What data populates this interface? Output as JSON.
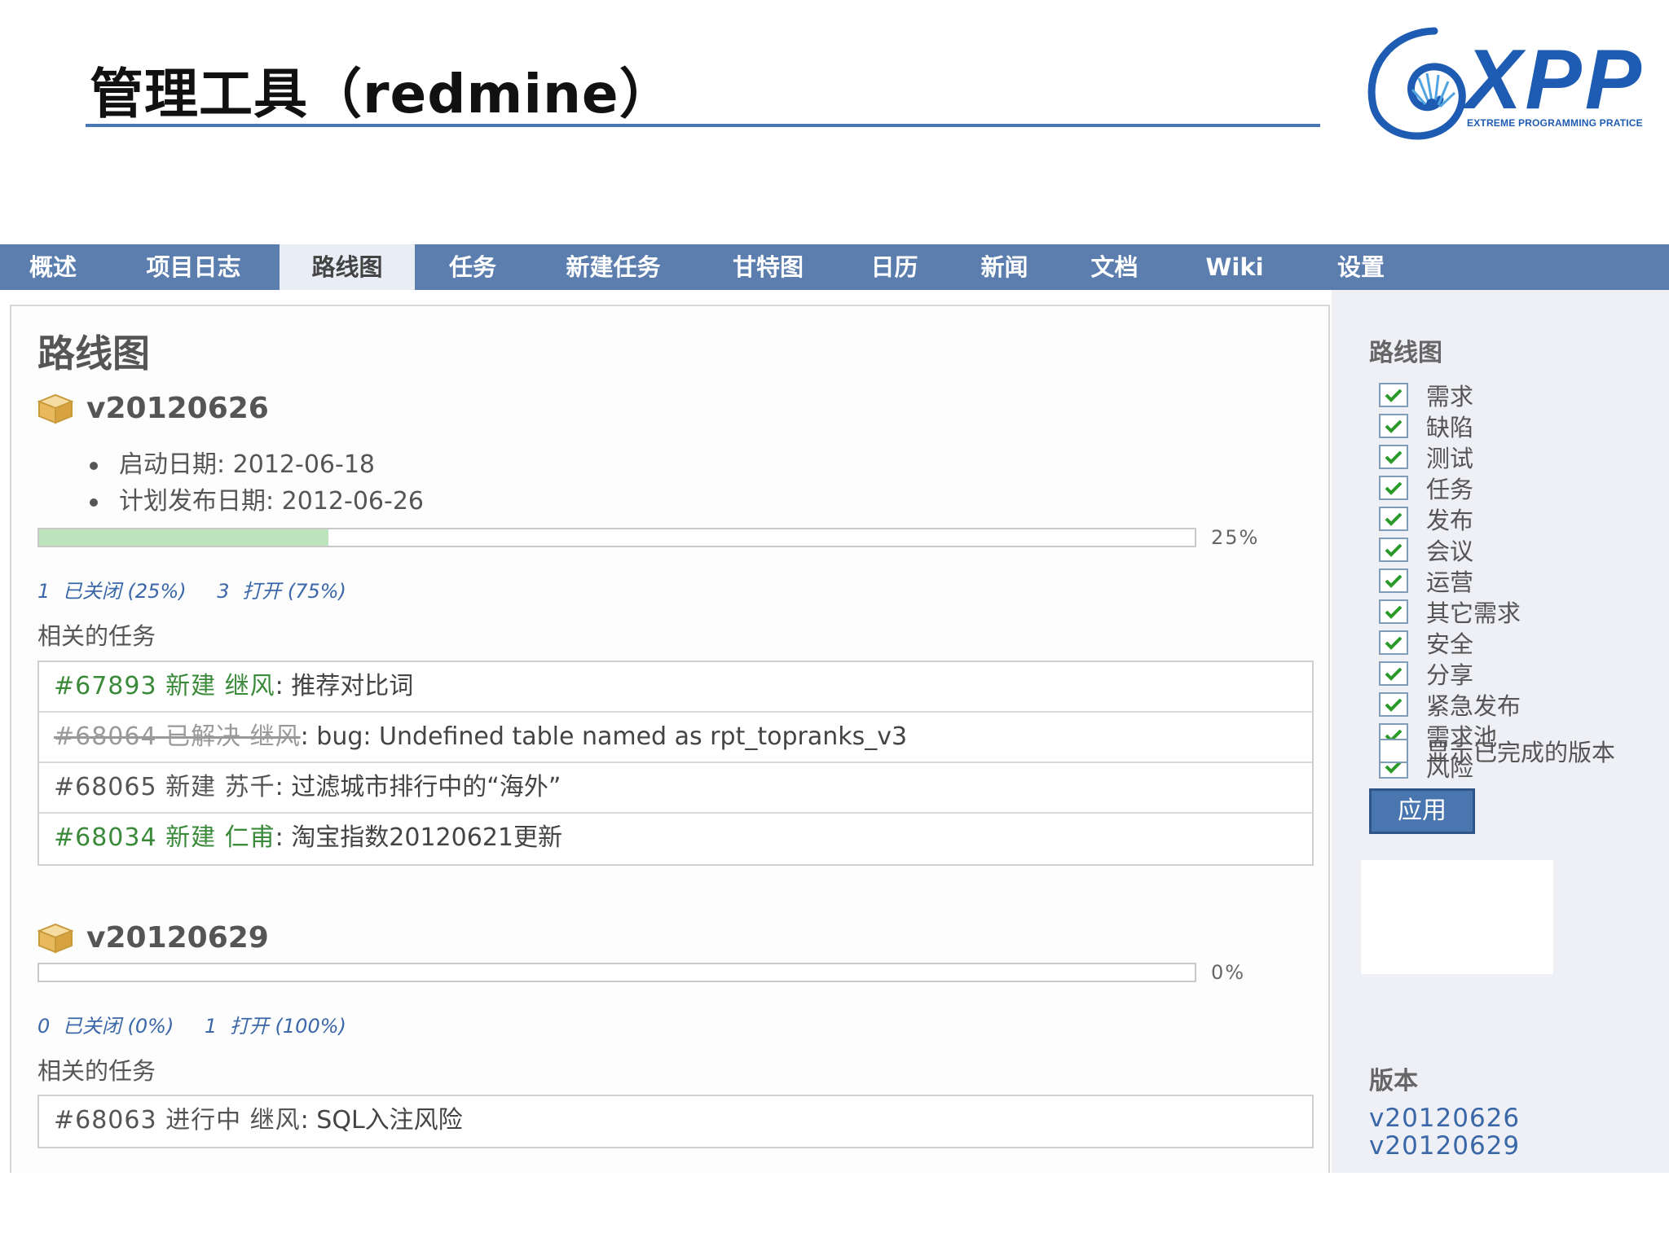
{
  "slide": {
    "title": "管理工具（redmine）",
    "logo_text": "XPP",
    "logo_subtext": "EXTREME PROGRAMMING PRATICE"
  },
  "nav": {
    "tabs": [
      {
        "label": "概述"
      },
      {
        "label": "项目日志"
      },
      {
        "label": "路线图",
        "selected": true
      },
      {
        "label": "任务"
      },
      {
        "label": "新建任务"
      },
      {
        "label": "甘特图"
      },
      {
        "label": "日历"
      },
      {
        "label": "新闻"
      },
      {
        "label": "文档"
      },
      {
        "label": "Wiki"
      },
      {
        "label": "设置"
      }
    ]
  },
  "main": {
    "heading": "路线图",
    "versions": [
      {
        "name": "v20120626",
        "start_date": "启动日期: 2012-06-18",
        "due_date": "计划发布日期: 2012-06-26",
        "progress": 25,
        "progress_label": "25%",
        "closed_count": "1",
        "closed_label": "已关闭 (25%)",
        "open_count": "3",
        "open_label": "打开 (75%)",
        "related_label": "相关的任务",
        "issues": [
          {
            "link": "#67893 新建 继风",
            "subject": ": 推荐对比词",
            "status": "new"
          },
          {
            "link": "#68064 已解决 继风",
            "subject": ": bug: Undefined table named as rpt_topranks_v3",
            "status": "closed"
          },
          {
            "link": "#68065 新建 苏千",
            "subject": ": 过滤城市排行中的“海外”",
            "status": "plain"
          },
          {
            "link": "#68034 新建 仁甫",
            "subject": ": 淘宝指数20120621更新",
            "status": "new"
          }
        ]
      },
      {
        "name": "v20120629",
        "progress": 0,
        "progress_label": "0%",
        "closed_count": "0",
        "closed_label": "已关闭 (0%)",
        "open_count": "1",
        "open_label": "打开 (100%)",
        "related_label": "相关的任务",
        "issues": [
          {
            "link": "#68063 进行中 继风",
            "subject": ": SQL入注风险",
            "status": "plain"
          }
        ]
      }
    ]
  },
  "sidebar": {
    "heading": "路线图",
    "trackers": [
      "需求",
      "缺陷",
      "测试",
      "任务",
      "发布",
      "会议",
      "运营",
      "其它需求",
      "安全",
      "分享",
      "紧急发布",
      "需求池",
      "风险"
    ],
    "show_completed": "显示已完成的版本",
    "apply": "应用",
    "versions_heading": "版本",
    "version_links": [
      "v20120626",
      "v20120629"
    ]
  },
  "colors": {
    "nav_bg": "#5b7eaf",
    "progress_done": "#bde3bd",
    "link_blue": "#3a67a8",
    "issue_green": "#3a8a3a",
    "brand_blue": "#1e5cb3"
  }
}
